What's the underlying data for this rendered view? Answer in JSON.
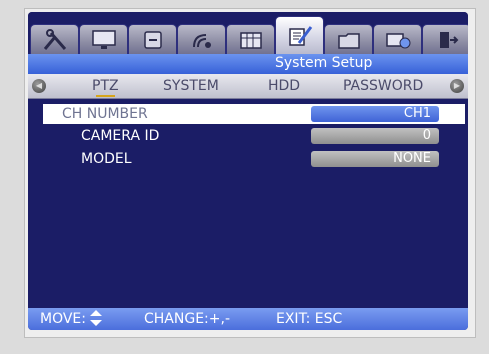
{
  "title": "System Setup",
  "tabs": [
    {
      "icon": "tools-icon"
    },
    {
      "icon": "monitor-icon"
    },
    {
      "icon": "record-icon"
    },
    {
      "icon": "event-icon"
    },
    {
      "icon": "schedule-icon"
    },
    {
      "icon": "system-settings-icon",
      "active": true
    },
    {
      "icon": "backup-folder-icon"
    },
    {
      "icon": "network-icon"
    },
    {
      "icon": "exit-icon"
    }
  ],
  "subtabs": [
    "PTZ",
    "SYSTEM",
    "HDD",
    "PASSWORD"
  ],
  "active_subtab": "PTZ",
  "rows": [
    {
      "label": "CH NUMBER",
      "value": "CH1"
    },
    {
      "label": "CAMERA ID",
      "value": "0"
    },
    {
      "label": "MODEL",
      "value": "NONE"
    }
  ],
  "footer": {
    "move": "MOVE:",
    "change": "CHANGE:+,-",
    "exit": "EXIT: ESC"
  }
}
